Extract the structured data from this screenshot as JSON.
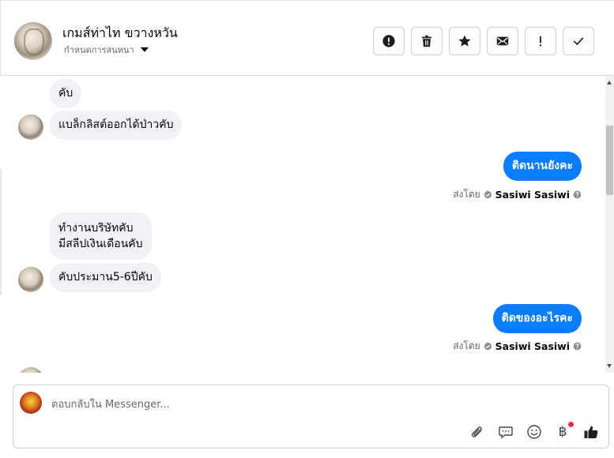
{
  "header": {
    "name": "เกมส์ท่าไท ขวางหวัน",
    "subtitle": "กำหนดการสนทนา",
    "buttons": [
      {
        "icon": "alert-circle-icon"
      },
      {
        "icon": "trash-icon"
      },
      {
        "icon": "star-icon"
      },
      {
        "icon": "envelope-icon"
      },
      {
        "icon": "exclamation-icon",
        "label": "!"
      },
      {
        "icon": "checkmark-icon"
      }
    ]
  },
  "messages": {
    "m1": "คับ",
    "m2": "แบล็กลิสต์ออกได้ป่าวคับ",
    "m3": "ติดนานยังคะ",
    "m3_sent_prefix": "ส่งโดย",
    "m3_sent_by": "Sasiwi Sasiwi",
    "m4_line1": "ทำงานบริษัทคับ",
    "m4_line2": "มีสลีปเงินเดือนคับ",
    "m5": "คับประมาน5-6ปีคับ",
    "m6": "ติดของอะไรคะ",
    "m6_sent_prefix": "ส่งโดย",
    "m6_sent_by": "Sasiwi Sasiwi"
  },
  "composer": {
    "placeholder": "ตอบกลับใน Messenger...",
    "tools": [
      "paperclip-icon",
      "speech-bubble-icon",
      "smiley-icon",
      "baht-icon",
      "thumbs-up-icon"
    ],
    "baht_symbol": "฿"
  },
  "colors": {
    "outgoing_bubble": "#0a7cff",
    "incoming_bubble": "#f0f2f5",
    "notification_dot": "#f02849"
  }
}
